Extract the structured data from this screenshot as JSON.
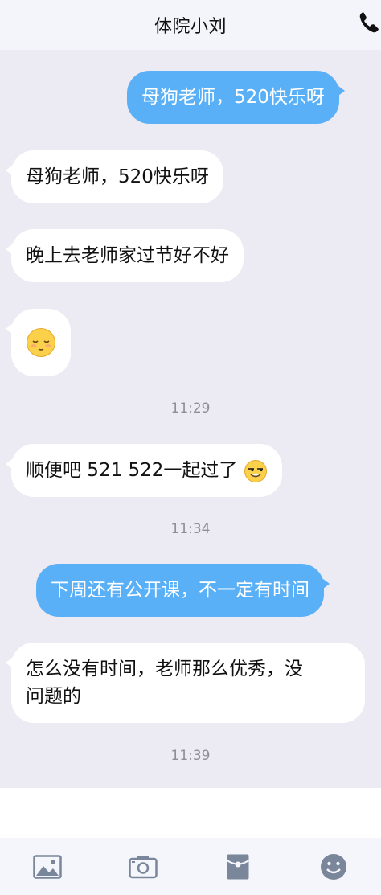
{
  "header": {
    "title": "体院小刘"
  },
  "messages": [
    {
      "type": "out",
      "text": "母狗老师，520快乐呀"
    },
    {
      "type": "in",
      "text": "母狗老师，520快乐呀"
    },
    {
      "type": "in",
      "text": "晚上去老师家过节好不好"
    },
    {
      "type": "in",
      "emoji": "content-face-emoji"
    },
    {
      "type": "time",
      "text": "11:29"
    },
    {
      "type": "in",
      "text": "顺便吧 521 522一起过了",
      "emoji": "smirk-face-emoji"
    },
    {
      "type": "time",
      "text": "11:34"
    },
    {
      "type": "out",
      "text": "下周还有公开课，不一定有时间"
    },
    {
      "type": "in",
      "lines": [
        "怎么没有时间，老师那么优秀，没",
        "问题的"
      ]
    },
    {
      "type": "time",
      "text": "11:39"
    }
  ],
  "toolbar": [
    "image-icon",
    "camera-icon",
    "red-packet-icon",
    "emoji-icon"
  ],
  "colors": {
    "outgoing_bubble": "#5ab0f7",
    "incoming_bubble": "#ffffff",
    "background": "#eceaf3"
  }
}
